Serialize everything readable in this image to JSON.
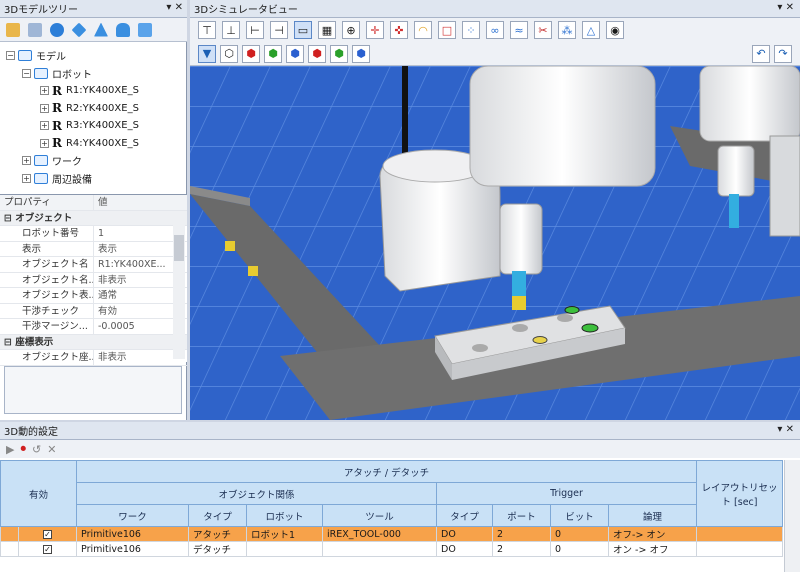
{
  "tree_panel": {
    "title": "3Dモデルツリー",
    "controls": "▾ ✕",
    "items": [
      {
        "label": "モデル",
        "indent": 0,
        "kind": "folder"
      },
      {
        "label": "ロボット",
        "indent": 1,
        "kind": "folder"
      },
      {
        "label": "R1:YK400XE_S",
        "indent": 2,
        "kind": "robot"
      },
      {
        "label": "R2:YK400XE_S",
        "indent": 2,
        "kind": "robot"
      },
      {
        "label": "R3:YK400XE_S",
        "indent": 2,
        "kind": "robot"
      },
      {
        "label": "R4:YK400XE_S",
        "indent": 2,
        "kind": "robot"
      },
      {
        "label": "ワーク",
        "indent": 1,
        "kind": "folder"
      },
      {
        "label": "周辺設備",
        "indent": 1,
        "kind": "folder"
      }
    ]
  },
  "properties": {
    "col_property": "プロパティ",
    "col_value": "値",
    "cat_object": "オブジェクト",
    "cat_coords": "座標表示",
    "rows": [
      {
        "key": "ロボット番号",
        "value": "1"
      },
      {
        "key": "表示",
        "value": "表示"
      },
      {
        "key": "オブジェクト名",
        "value": "R1:YK400XE..."
      },
      {
        "key": "オブジェクト名...",
        "value": "非表示"
      },
      {
        "key": "オブジェクト表...",
        "value": "通常"
      },
      {
        "key": "干渉チェック",
        "value": "有効"
      },
      {
        "key": "干渉マージン...",
        "value": "-0.0005"
      }
    ],
    "coord_rows": [
      {
        "key": "オブジェクト座...",
        "value": "非表示"
      }
    ]
  },
  "sim_panel": {
    "title": "3Dシミュレータビュー",
    "controls": "▾ ✕"
  },
  "dyn_panel": {
    "title": "3D動的設定",
    "controls": "▾ ✕",
    "header": {
      "enabled": "有効",
      "attach_detach": "アタッチ / デタッチ",
      "object_relation": "オブジェクト関係",
      "trigger": "Trigger",
      "layout_reset": "レイアウトリセット [sec]",
      "cols": [
        "ワーク",
        "タイプ",
        "ロボット",
        "ツール",
        "タイプ",
        "ポート",
        "ビット",
        "論理"
      ]
    },
    "rows": [
      {
        "checked": "✓",
        "work": "Primitive106",
        "type": "アタッチ",
        "robot": "ロボット1",
        "tool": "iREX_TOOL-000",
        "ttype": "DO",
        "port": "2",
        "bit": "0",
        "logic": "オフ-> オン",
        "reset": ""
      },
      {
        "checked": "✓",
        "work": "Primitive106",
        "type": "デタッチ",
        "robot": "",
        "tool": "",
        "ttype": "DO",
        "port": "2",
        "bit": "0",
        "logic": "オン -> オフ",
        "reset": ""
      }
    ]
  }
}
